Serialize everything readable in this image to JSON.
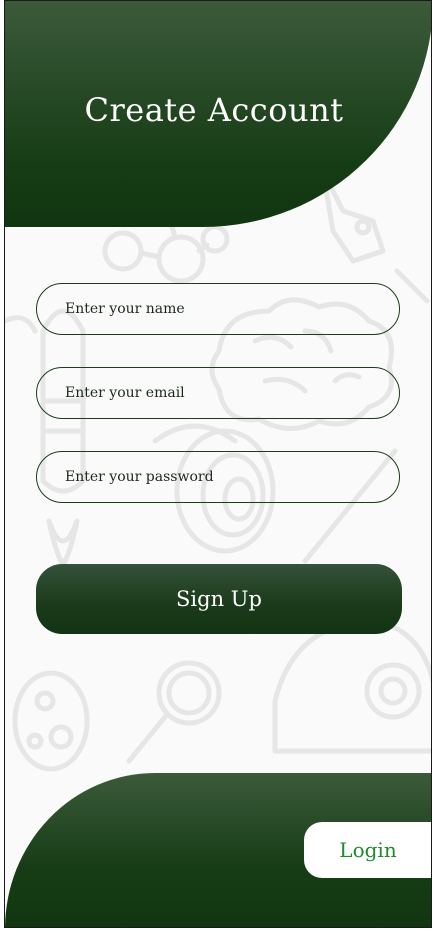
{
  "header": {
    "title": "Create Account"
  },
  "form": {
    "name_placeholder": "Enter your name",
    "email_placeholder": "Enter your email",
    "password_placeholder": "Enter your password",
    "name_value": "",
    "email_value": "",
    "password_value": "",
    "signup_label": "Sign Up"
  },
  "footer": {
    "login_label": "Login"
  },
  "colors": {
    "primary_green": "#173d16",
    "login_text": "#1f8a2c",
    "background": "#fafafa"
  }
}
